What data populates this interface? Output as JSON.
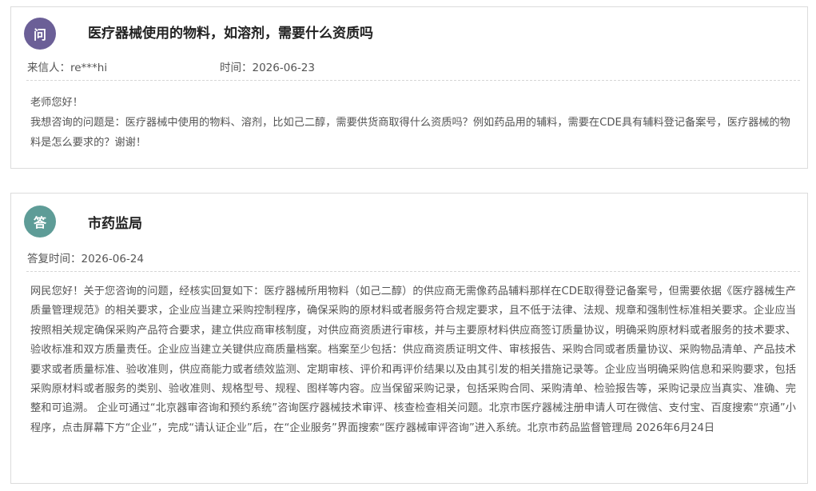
{
  "question": {
    "badge": "问",
    "title": "医疗器械使用的物料，如溶剂，需要什么资质吗",
    "sender_label": "来信人：",
    "sender": "re***hi",
    "time_label": "时间：",
    "time": "2026-06-23",
    "greeting": "老师您好！",
    "content": "我想咨询的问题是：医疗器械中使用的物料、溶剂，比如己二醇，需要供货商取得什么资质吗？例如药品用的辅料，需要在CDE具有辅料登记备案号，医疗器械的物料是怎么要求的？谢谢！"
  },
  "answer": {
    "badge": "答",
    "department": "市药监局",
    "reply_time_label": "答复时间：",
    "reply_time": "2026-06-24",
    "content": "网民您好！关于您咨询的问题，经核实回复如下：医疗器械所用物料（如己二醇）的供应商无需像药品辅料那样在CDE取得登记备案号，但需要依据《医疗器械生产质量管理规范》的相关要求，企业应当建立采购控制程序，确保采购的原材料或者服务符合规定要求，且不低于法律、法规、规章和强制性标准相关要求。企业应当按照相关规定确保采购产品符合要求，建立供应商审核制度，对供应商资质进行审核，并与主要原材料供应商签订质量协议，明确采购原材料或者服务的技术要求、验收标准和双方质量责任。企业应当建立关键供应商质量档案。档案至少包括：供应商资质证明文件、审核报告、采购合同或者质量协议、采购物品清单、产品技术要求或者质量标准、验收准则，供应商能力或者绩效监测、定期审核、评价和再评价结果以及由其引发的相关措施记录等。企业应当明确采购信息和采购要求，包括采购原材料或者服务的类别、验收准则、规格型号、规程、图样等内容。应当保留采购记录，包括采购合同、采购清单、检验报告等，采购记录应当真实、准确、完整和可追溯。 企业可通过“北京器审咨询和预约系统”咨询医疗器械技术审评、核查检查相关问题。北京市医疗器械注册申请人可在微信、支付宝、百度搜索“京通”小程序，点击屏幕下方“企业”，完成“请认证企业”后，在“企业服务”界面搜索“医疗器械审评咨询”进入系统。北京市药品监督管理局  2026年6月24日"
  },
  "colors": {
    "question_badge": "#6b5f97",
    "answer_badge": "#5e9c97",
    "border": "#dcdcdc",
    "divider": "#d6d6d6"
  }
}
